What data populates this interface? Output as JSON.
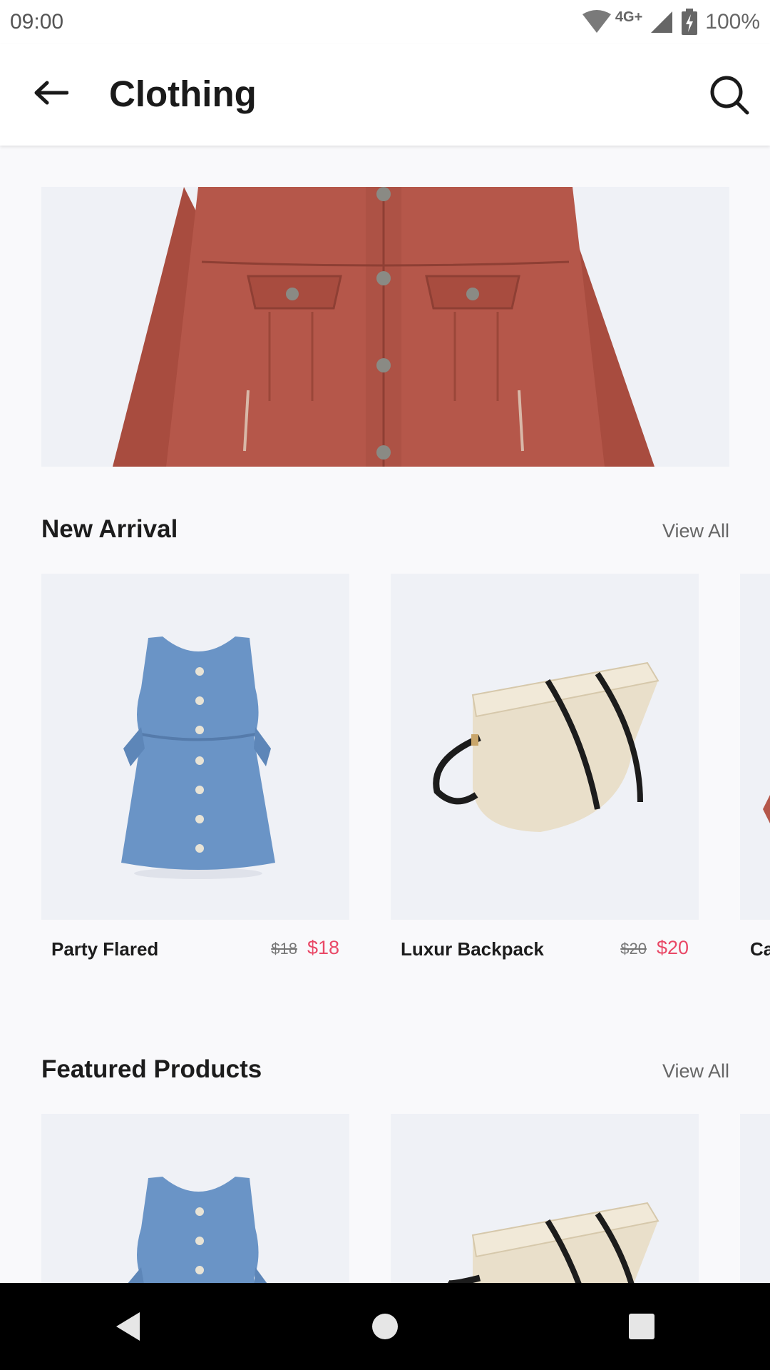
{
  "status_bar": {
    "time": "09:00",
    "network": "4G+",
    "battery": "100%",
    "icons": [
      "wifi-icon",
      "cell-signal-icon",
      "battery-charging-icon"
    ]
  },
  "app_bar": {
    "title": "Clothing",
    "back_icon": "arrow-left-icon",
    "search_icon": "search-icon"
  },
  "hero": {
    "image": "red-denim-jacket"
  },
  "new_arrival": {
    "title": "New Arrival",
    "view_all": "View All",
    "items": [
      {
        "name": "Party Flared",
        "old_price": "$18",
        "price": "$18",
        "image": "denim-dress"
      },
      {
        "name": "Luxur Backpack",
        "old_price": "$20",
        "price": "$20",
        "image": "canvas-bag"
      },
      {
        "name": "Ca",
        "image": "partial-product"
      }
    ]
  },
  "featured": {
    "title": "Featured Products",
    "view_all": "View All",
    "items": [
      {
        "image": "denim-dress"
      },
      {
        "image": "canvas-bag"
      },
      {
        "image": "partial-product"
      }
    ]
  },
  "colors": {
    "accent_price": "#e94866",
    "card_bg": "#eff1f6",
    "jacket": "#b5574a"
  },
  "nav_bar": {
    "buttons": [
      "back-triangle-icon",
      "home-circle-icon",
      "recents-square-icon"
    ]
  }
}
